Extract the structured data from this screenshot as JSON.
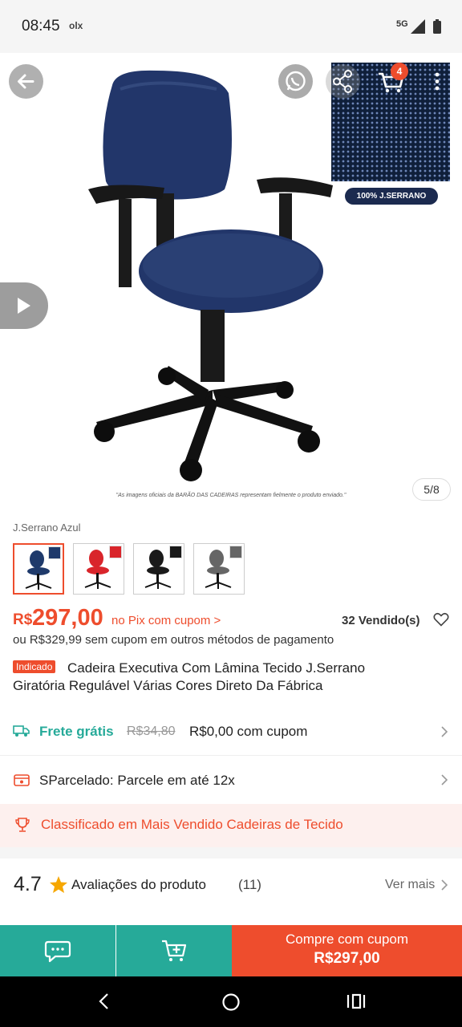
{
  "status_bar": {
    "time": "08:45",
    "app_indicator": "olx",
    "network": "5G",
    "signal_icon": "signal-icon",
    "battery_icon": "battery-icon"
  },
  "gallery": {
    "image_counter": "5/8",
    "disclaimer": "\"As imagens oficiais da BARÃO DAS CADEIRAS representam fielmente o produto enviado.\"",
    "brand_badge": "100% J.SERRANO",
    "cart_count": "4",
    "icons": [
      "back-arrow-icon",
      "whatsapp-icon",
      "share-icon",
      "cart-icon",
      "more-vertical-icon",
      "play-icon"
    ]
  },
  "variants": {
    "selected_label": "J.Serrano Azul",
    "options": [
      {
        "color": "#1f3a6b",
        "selected": true
      },
      {
        "color": "#d9252b",
        "selected": false
      },
      {
        "color": "#1a1a1a",
        "selected": false
      },
      {
        "color": "#666666",
        "selected": false
      }
    ]
  },
  "price": {
    "currency": "R$",
    "value": "297,00",
    "pix_note": "no Pix com cupom >",
    "sold": "32 Vendido(s)",
    "alt_price": "ou R$329,99 sem cupom em outros métodos de pagamento"
  },
  "product": {
    "badge": "Indicado",
    "title_line1": "Cadeira Executiva Com Lâmina Tecido J.Serrano",
    "title_line2": "Giratória Regulável Várias Cores Direto Da Fábrica"
  },
  "shipping": {
    "free_label": "Frete grátis",
    "old_price": "R$34,80",
    "new_price": "R$0,00 com cupom"
  },
  "installments": {
    "text": "SParcelado: Parcele em até 12x"
  },
  "ranking": {
    "text": "Classificado em Mais Vendido Cadeiras de Tecido"
  },
  "reviews": {
    "score": "4.7",
    "label": "Avaliações do produto",
    "count": "(11)",
    "more": "Ver mais"
  },
  "bottom_bar": {
    "buy_label": "Compre com cupom",
    "buy_price": "R$297,00"
  },
  "colors": {
    "accent": "#ee4d2d",
    "teal": "#26aa99"
  }
}
